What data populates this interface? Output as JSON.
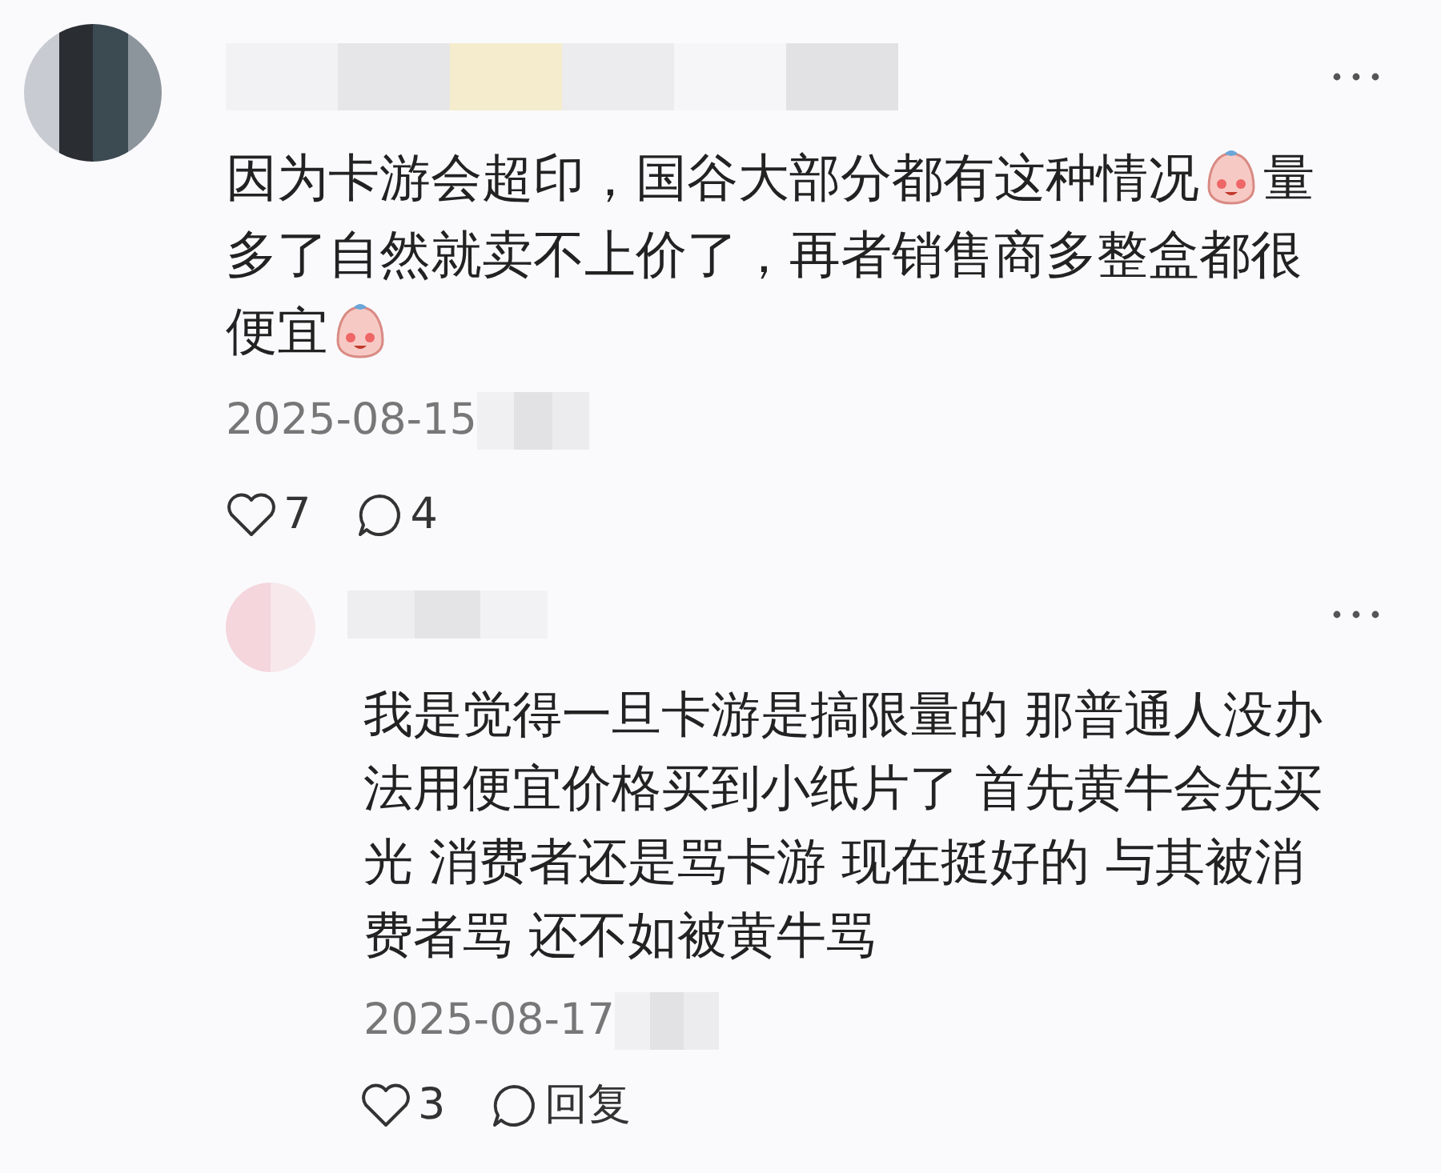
{
  "comments": [
    {
      "body": [
        [
          {
            "kind": "text",
            "text": "因为卡游会超印，国谷大部分都有这种情况"
          },
          {
            "kind": "emoji"
          },
          {
            "kind": "text",
            "text": "量"
          }
        ],
        [
          {
            "kind": "text",
            "text": "多了自然就卖不上价了，再者销售商多整盒都很"
          }
        ],
        [
          {
            "kind": "text",
            "text": "便宜"
          },
          {
            "kind": "emoji"
          }
        ]
      ],
      "date": "2025-08-15",
      "likes": "7",
      "replies": "4",
      "reply": {
        "body": [
          [
            {
              "kind": "text",
              "text": "我是觉得一旦卡游是搞限量的 那普通人没办"
            }
          ],
          [
            {
              "kind": "text",
              "text": "法用便宜价格买到小纸片了 首先黄牛会先买"
            }
          ],
          [
            {
              "kind": "text",
              "text": "光 消费者还是骂卡游 现在挺好的 与其被消"
            }
          ],
          [
            {
              "kind": "text",
              "text": "费者骂 还不如被黄牛骂"
            }
          ]
        ],
        "date": "2025-08-17",
        "likes": "3",
        "reply_label": "回复"
      }
    }
  ]
}
